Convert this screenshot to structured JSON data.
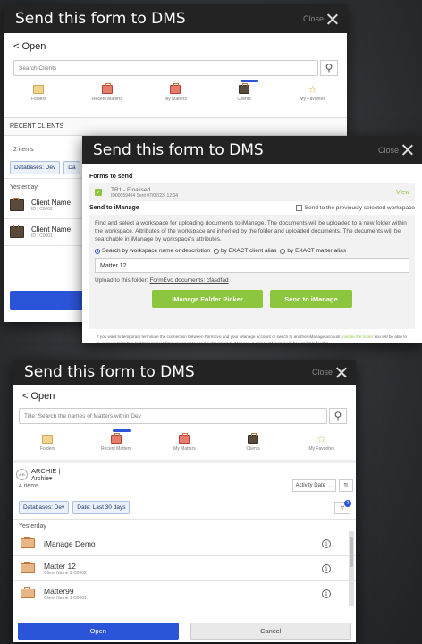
{
  "common": {
    "title": "Send this form to DMS",
    "close_label": "Close",
    "open_label": "Open",
    "back_glyph": "<"
  },
  "panel1": {
    "search_placeholder": "Search Clients",
    "tabs": [
      "Folders",
      "Recent Matters",
      "My Matters",
      "Clients",
      "My Favorites"
    ],
    "active_tab": "Clients",
    "section": "RECENT CLIENTS",
    "count": "2 items",
    "chips": [
      "Databases: Dev",
      "Da"
    ],
    "group": "Yesterday",
    "items": [
      {
        "name": "Client Name",
        "sub": "ID | C0002"
      },
      {
        "name": "Client Name",
        "sub": "ID | C0001"
      }
    ]
  },
  "panel2": {
    "forms_header": "Forms to send",
    "form_name": "TR1 - Finalised",
    "form_meta": "ID00059494   Sent 07/02/23, 12:04",
    "view_label": "View",
    "send_header": "Send to iManage",
    "checkbox_label": "Send to the previously selected workspace",
    "description": "Find and select a workspace for uploading documents to iManage. The documents will be uploaded to a new folder within the workspace. Attributes of the workspace are inherited by the folder and uploaded documents. The documents will be searchable in iManage by workspace's attributes.",
    "radios": [
      "Search by workspace name or description",
      "by EXACT client alias",
      "by EXACT matter alias"
    ],
    "input_value": "Matter 12",
    "upload_label": "Upload to this folder:",
    "upload_link": "FormEvo documents: cfasdfad",
    "picker_btn": "iManage Folder Picker",
    "send_btn": "Send to iManage",
    "footnote_a": "If you want to temporary terminate the connection between FormEvo and your iManage account or switch to another iManage account, ",
    "footnote_link": "revoke the token",
    "footnote_b": " You will be able to re-connect FormEvo to iManage next time you need to send a document to iManage. 'Login to iManage' will be available for this."
  },
  "panel3": {
    "search_placeholder": "Title: Search the names of Matters within Dev",
    "tabs": [
      "Folders",
      "Recent Matters",
      "My Matters",
      "Clients",
      "My Favorites"
    ],
    "active_tab": "Recent Matters",
    "avatar_initials": "A.R",
    "user_line": "ARCHIE |",
    "user_name": "Archie",
    "count": "4 items",
    "sort_label": "Activity Date",
    "chips": [
      "Databases: Dev",
      "Date: Last 30 days"
    ],
    "filter_badge": "2",
    "group": "Yesterday",
    "items": [
      {
        "name": "iManage Demo",
        "sub": ""
      },
      {
        "name": "Matter 12",
        "sub": "Client Name 2 C0002"
      },
      {
        "name": "Matter99",
        "sub": "Client Name 1 C0001"
      }
    ],
    "open_btn": "Open",
    "cancel_btn": "Cancel"
  }
}
